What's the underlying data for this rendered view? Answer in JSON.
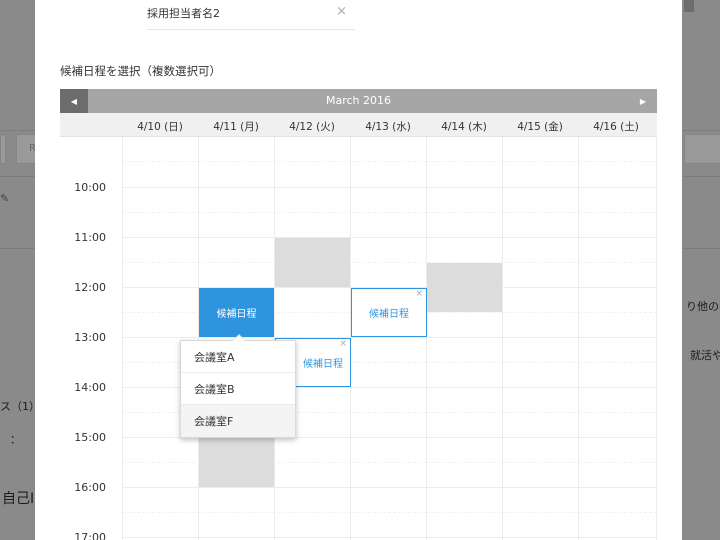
{
  "recruiter": {
    "value": "採用担当者名2",
    "clear_icon": "×"
  },
  "section_label": "候補日程を選択（複数選択可）",
  "calendar": {
    "month": "March 2016",
    "prev_icon": "◀",
    "next_icon": "▶",
    "days": [
      "4/10 (日)",
      "4/11 (月)",
      "4/12 (火)",
      "4/13 (水)",
      "4/14 (木)",
      "4/15 (金)",
      "4/16 (土)"
    ],
    "times": [
      "10:00",
      "11:00",
      "12:00",
      "13:00",
      "14:00",
      "15:00",
      "16:00",
      "17:00"
    ],
    "slot_label": "候補日程",
    "slot_remove_icon": "×"
  },
  "room_dropdown": {
    "items": [
      "会議室A",
      "会議室B",
      "会議室F"
    ],
    "hovered_index": 2
  },
  "background": {
    "btn_letter": "R",
    "text_other": "り他の名",
    "text_job": "就活や",
    "text_list": "ス（1）",
    "text_colon": "：",
    "text_self": "自己I",
    "pen_icon": "✎"
  }
}
